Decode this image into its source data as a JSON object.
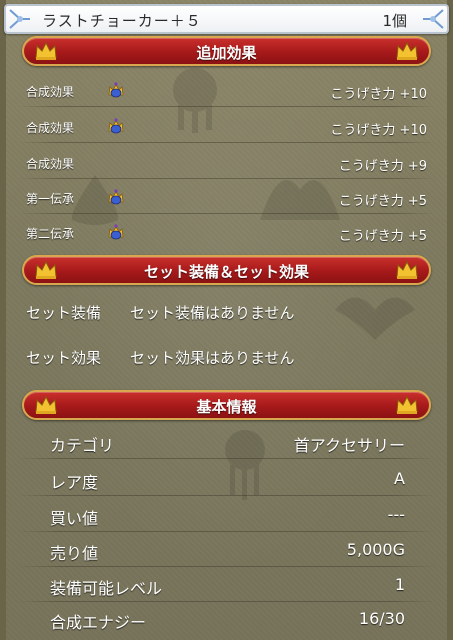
{
  "title_bar": {
    "item_name": "ラストチョーカー＋５",
    "quantity": "1個"
  },
  "sections": {
    "bonus_effects": {
      "header": "追加効果",
      "rows": [
        {
          "label": "合成効果",
          "icon": "crown-gem-icon",
          "value": "こうげき力 +10"
        },
        {
          "label": "合成効果",
          "icon": "crown-gem-icon",
          "value": "こうげき力 +10"
        },
        {
          "label": "合成効果",
          "icon": "",
          "value": "こうげき力 +9"
        },
        {
          "label": "第一伝承",
          "icon": "crown-gem-icon",
          "value": "こうげき力 +5"
        },
        {
          "label": "第二伝承",
          "icon": "crown-gem-icon",
          "value": "こうげき力 +5"
        }
      ]
    },
    "set": {
      "header": "セット装備＆セット効果",
      "rows": [
        {
          "label": "セット装備",
          "value": "セット装備はありません"
        },
        {
          "label": "セット効果",
          "value": "セット効果はありません"
        }
      ]
    },
    "basic_info": {
      "header": "基本情報",
      "rows": [
        {
          "label": "カテゴリ",
          "value": "首アクセサリー"
        },
        {
          "label": "レア度",
          "value": "A"
        },
        {
          "label": "買い値",
          "value": "---"
        },
        {
          "label": "売り値",
          "value": "5,000G"
        },
        {
          "label": "装備可能レベル",
          "value": "1"
        },
        {
          "label": "合成エナジー",
          "value": "16/30"
        }
      ]
    }
  },
  "colors": {
    "panel_bg": "#7e7a5f",
    "header_red": "#a6191a",
    "header_border": "#d9a84e",
    "crown_gold": "#f2c230",
    "gem_blue": "#3a5fd0",
    "gem_purple": "#7a3fb0"
  }
}
